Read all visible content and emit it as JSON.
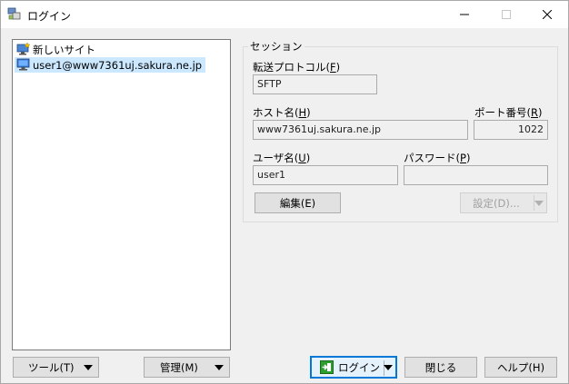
{
  "window": {
    "title": "ログイン"
  },
  "site_tree": {
    "items": [
      {
        "label": "新しいサイト",
        "icon": "new-site-icon",
        "selected": false
      },
      {
        "label": "user1@www7361uj.sakura.ne.jp",
        "icon": "computer-icon",
        "selected": true
      }
    ]
  },
  "session": {
    "group_label": "セッション",
    "protocol": {
      "label": "転送プロトコル",
      "accel": "F",
      "value": "SFTP"
    },
    "host": {
      "label": "ホスト名",
      "accel": "H",
      "value": "www7361uj.sakura.ne.jp"
    },
    "port": {
      "label": "ポート番号",
      "accel": "R",
      "value": "1022"
    },
    "user": {
      "label": "ユーザ名",
      "accel": "U",
      "value": "user1"
    },
    "password": {
      "label": "パスワード",
      "accel": "P",
      "value": ""
    },
    "edit_button": "編集(E)",
    "settings_button": "設定(D)..."
  },
  "footer": {
    "tools_button": "ツール(T)",
    "manage_button": "管理(M)",
    "login_button": "ログイン",
    "close_button": "閉じる",
    "help_button": "ヘルプ(H)"
  },
  "colors": {
    "selection": "#cce8ff",
    "primary_border": "#0078d7",
    "login_icon_green": "#2e9e2e"
  }
}
